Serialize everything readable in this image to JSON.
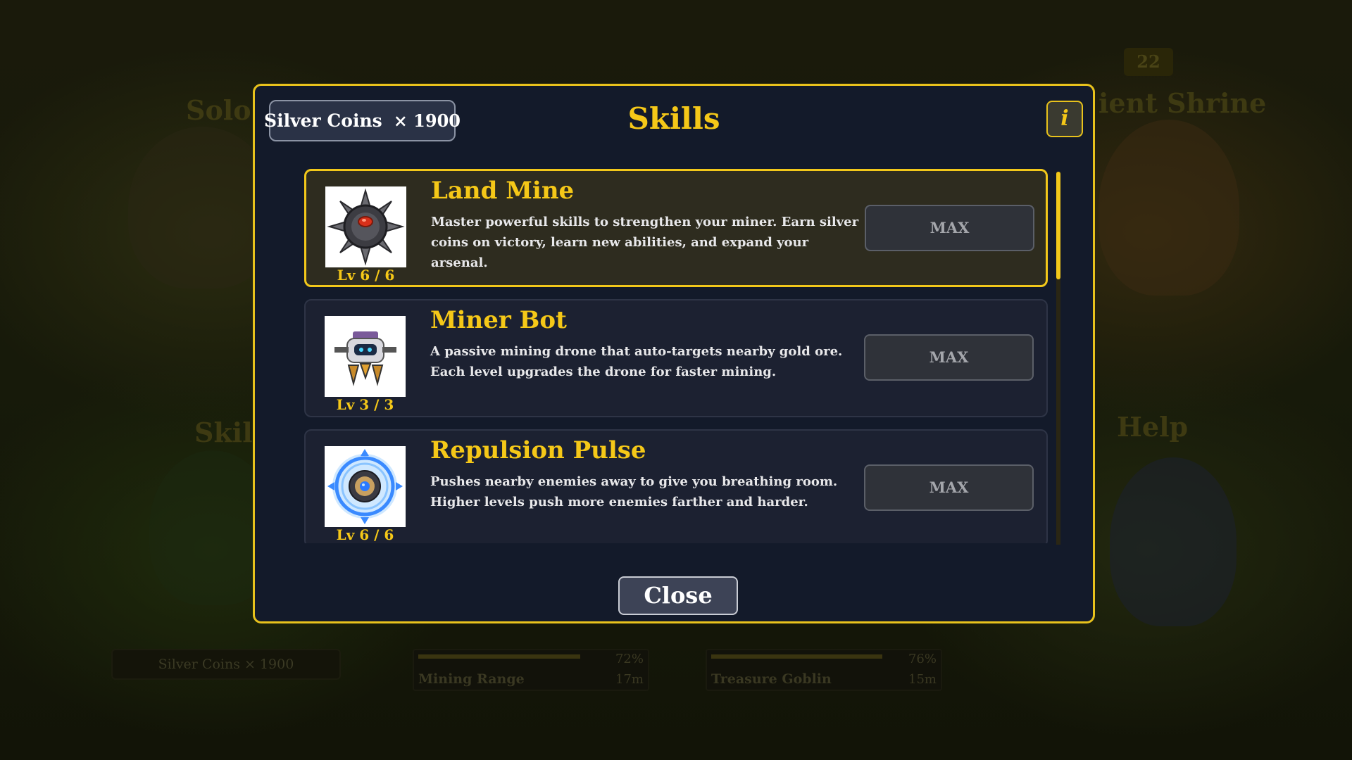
{
  "background": {
    "titles": {
      "solo": "Solo",
      "shrine": "ient Shrine",
      "skills": "Skil",
      "help": "Help"
    },
    "badge": "22",
    "coins_label": "Silver Coins × 1900",
    "bars": [
      {
        "label": "Mining Range",
        "percent": "72%",
        "fill": 0.72,
        "distance": "17m"
      },
      {
        "label": "Treasure Goblin",
        "percent": "76%",
        "fill": 0.76,
        "distance": "15m"
      }
    ]
  },
  "modal": {
    "title": "Skills",
    "coins": {
      "label": "Silver Coins",
      "multiplier": "× 1900"
    },
    "info_label": "i",
    "close_label": "Close",
    "scroll_position": 0,
    "skills": [
      {
        "name": "Land Mine",
        "icon": "land-mine-icon",
        "level": "Lv 6 / 6",
        "description": "Master powerful skills to strengthen your miner. Earn silver coins on victory, learn new abilities, and expand your arsenal.",
        "button": "MAX",
        "selected": true
      },
      {
        "name": "Miner Bot",
        "icon": "miner-bot-icon",
        "level": "Lv 3 / 3",
        "description": "A passive mining drone that auto-targets nearby gold ore. Each level upgrades the drone for faster mining.",
        "button": "MAX",
        "selected": false
      },
      {
        "name": "Repulsion Pulse",
        "icon": "repulsion-pulse-icon",
        "level": "Lv 6 / 6",
        "description": "Pushes nearby enemies away to give you breathing room. Higher levels push more enemies farther and harder.",
        "button": "MAX",
        "selected": false
      }
    ]
  },
  "colors": {
    "accent": "#f5c818",
    "modal_bg": "#131a2a",
    "card_bg": "#1c2131",
    "selected_card_bg": "#2e2c1f"
  }
}
